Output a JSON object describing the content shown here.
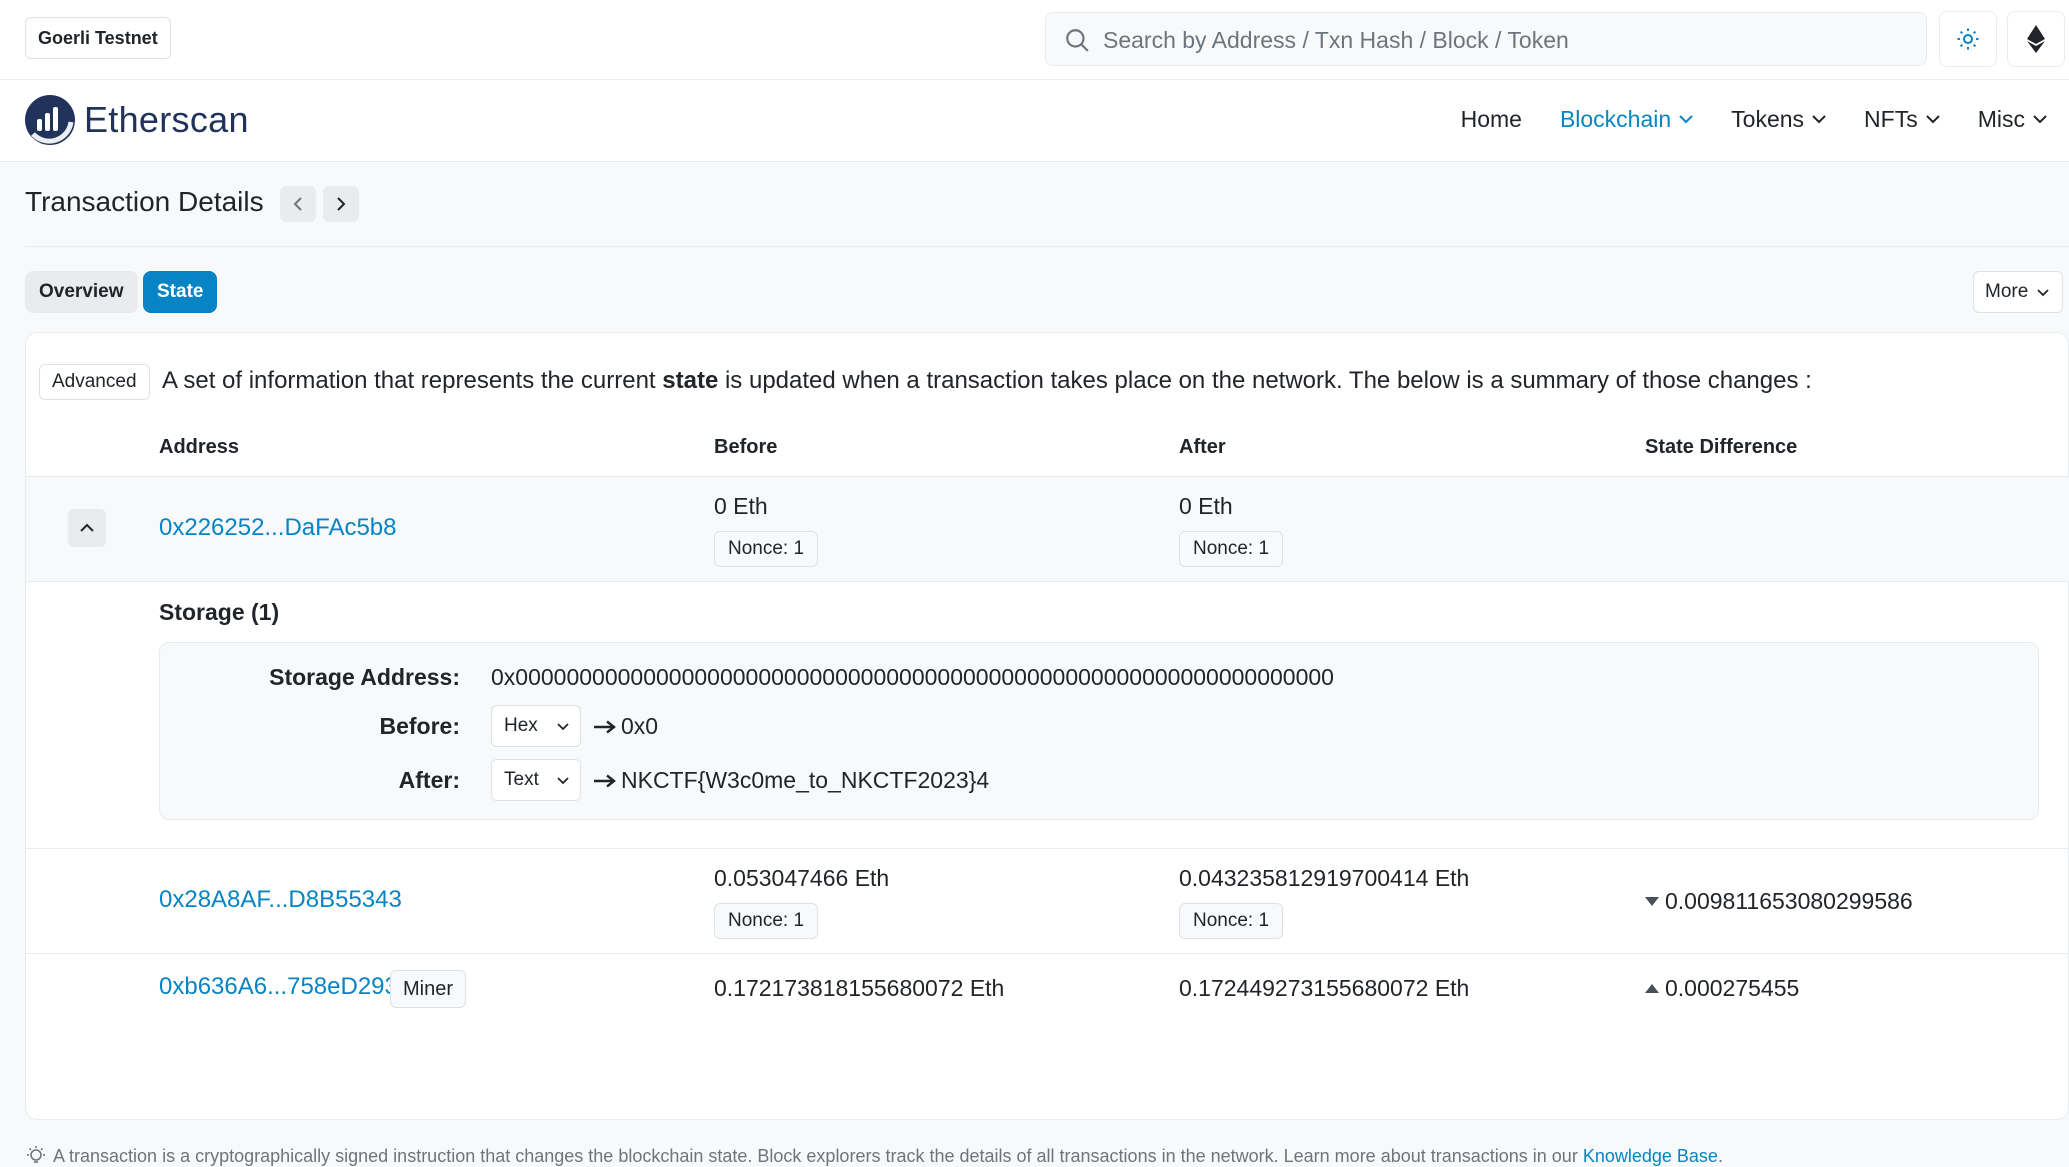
{
  "topbar": {
    "network": "Goerli Testnet",
    "search_placeholder": "Search by Address / Txn Hash / Block / Token"
  },
  "nav": {
    "logo": "Etherscan",
    "links": [
      {
        "label": "Home"
      },
      {
        "label": "Blockchain"
      },
      {
        "label": "Tokens"
      },
      {
        "label": "NFTs"
      },
      {
        "label": "Misc"
      }
    ]
  },
  "page": {
    "title": "Transaction Details",
    "tabs": [
      "Overview",
      "State"
    ],
    "more_label": "More"
  },
  "state": {
    "advanced_label": "Advanced",
    "intro_before": "A set of information that represents the current ",
    "intro_bold": "state",
    "intro_after": " is updated when a transaction takes place on the network. The below is a summary of those changes :",
    "headers": {
      "address": "Address",
      "before": "Before",
      "after": "After",
      "diff": "State Difference"
    },
    "rows": [
      {
        "address": "0x226252...DaFAc5b8",
        "before": "0 Eth",
        "before_nonce": "Nonce: 1",
        "after": "0 Eth",
        "after_nonce": "Nonce: 1",
        "diff": ""
      },
      {
        "address": "0x28A8AF...D8B55343",
        "before": "0.053047466 Eth",
        "before_nonce": "Nonce: 1",
        "after": "0.043235812919700414 Eth",
        "after_nonce": "Nonce: 1",
        "diff": "0.009811653080299586",
        "diff_direction": "down"
      },
      {
        "address": "0xb636A6...758eD293",
        "badge": "Miner",
        "before": "0.172173818155680072 Eth",
        "after": "0.172449273155680072 Eth",
        "diff": "0.000275455",
        "diff_direction": "up"
      }
    ],
    "storage": {
      "title": "Storage (1)",
      "address_label": "Storage Address:",
      "address_value": "0x0000000000000000000000000000000000000000000000000000000000000000",
      "before_label": "Before:",
      "before_format": "Hex",
      "before_value": "0x0",
      "after_label": "After:",
      "after_format": "Text",
      "after_value": "NKCTF{W3c0me_to_NKCTF2023}4"
    }
  },
  "footer": {
    "note": "A transaction is a cryptographically signed instruction that changes the blockchain state. Block explorers track the details of all transactions in the network. Learn more about transactions in our ",
    "link": "Knowledge Base",
    "end": "."
  },
  "colors": {
    "accent": "#0784c3",
    "logo_navy": "#21325b",
    "border": "#e9ecef",
    "page_bg": "#f8f9fa"
  }
}
